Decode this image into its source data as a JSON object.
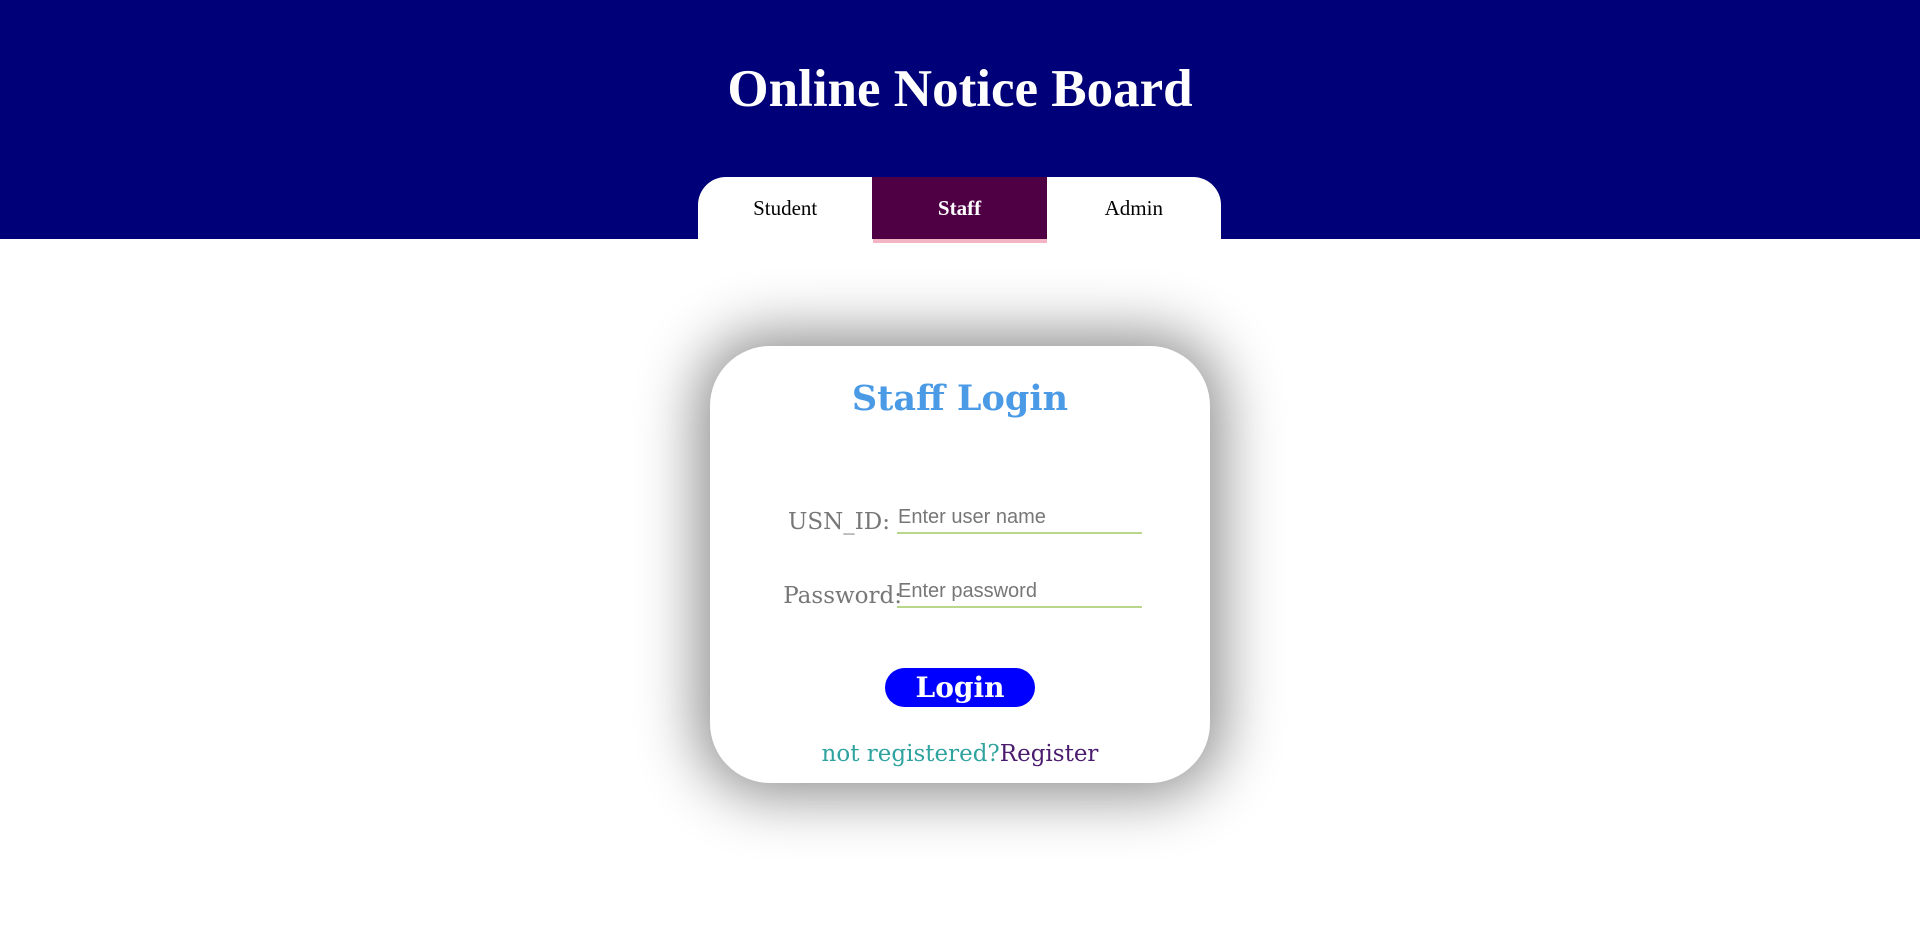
{
  "header": {
    "title": "Online Notice Board"
  },
  "tabs": [
    {
      "label": "Student",
      "active": false
    },
    {
      "label": "Staff",
      "active": true
    },
    {
      "label": "Admin",
      "active": false
    }
  ],
  "login": {
    "title": "Staff Login",
    "usn_label": "USN_ID:",
    "usn_placeholder": "Enter user name",
    "usn_value": "",
    "password_label": "Password:",
    "password_placeholder": "Enter password",
    "password_value": "",
    "button_label": "Login",
    "not_registered_text": "not registered?",
    "register_link": "Register"
  },
  "colors": {
    "header_bg": "#000078",
    "active_tab_bg": "#4f0045",
    "active_tab_underline": "#f3b5c3",
    "login_title": "#4a9ae6",
    "login_button": "#0000ff",
    "not_registered": "#2fa39f",
    "register_link": "#4b1b6e"
  }
}
